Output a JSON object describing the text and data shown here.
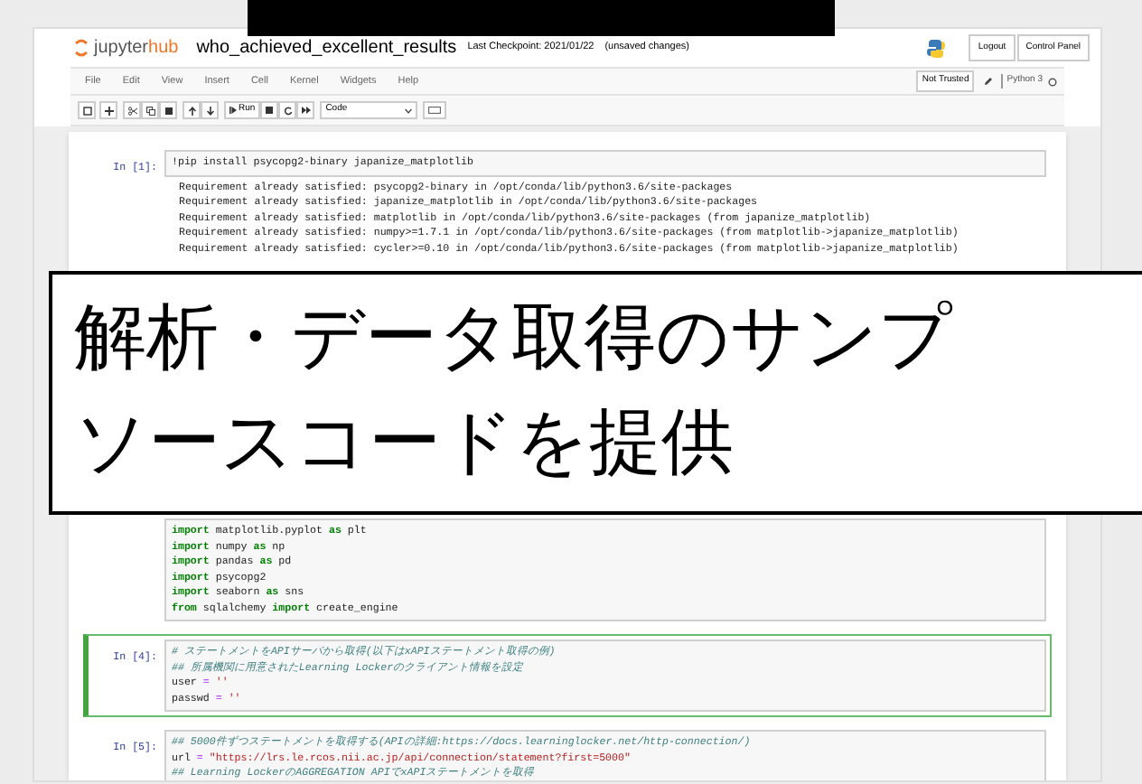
{
  "header": {
    "logo_prefix": "jupyter",
    "logo_suffix": "hub",
    "notebook_name": "who_achieved_excellent_results",
    "checkpoint": "Last Checkpoint: 2021/01/22",
    "unsaved": "(unsaved changes)",
    "buttons": [
      "Logout",
      "Control Panel"
    ]
  },
  "menu": {
    "items": [
      "File",
      "Edit",
      "View",
      "Insert",
      "Cell",
      "Kernel",
      "Widgets",
      "Help"
    ],
    "trust": "Not Trusted",
    "kernel": "Python 3"
  },
  "toolbar": {
    "run_label": "Run",
    "cell_type": "Code"
  },
  "cells": [
    {
      "prompt": "In [1]:",
      "selected": false,
      "lines": [
        [
          {
            "kind": "plain",
            "text": "!pip install psycopg2-binary japanize_matplotlib"
          }
        ]
      ],
      "outputs": [
        "Requirement already satisfied: psycopg2-binary in /opt/conda/lib/python3.6/site-packages",
        "Requirement already satisfied: japanize_matplotlib in /opt/conda/lib/python3.6/site-packages",
        "Requirement already satisfied: matplotlib in /opt/conda/lib/python3.6/site-packages (from japanize_matplotlib)",
        "Requirement already satisfied: numpy>=1.7.1 in /opt/conda/lib/python3.6/site-packages (from matplotlib->japanize_matplotlib)",
        "Requirement already satisfied: cycler>=0.10 in /opt/conda/lib/python3.6/site-packages (from matplotlib->japanize_matplotlib)"
      ]
    },
    {
      "selected": false,
      "lines": [
        [
          {
            "kind": "keyword",
            "text": "import"
          },
          {
            "kind": "plain",
            "text": " matplotlib.pyplot "
          },
          {
            "kind": "keyword",
            "text": "as"
          },
          {
            "kind": "plain",
            "text": " plt"
          }
        ],
        [
          {
            "kind": "keyword",
            "text": "import"
          },
          {
            "kind": "plain",
            "text": " numpy "
          },
          {
            "kind": "keyword",
            "text": "as"
          },
          {
            "kind": "plain",
            "text": " np"
          }
        ],
        [
          {
            "kind": "keyword",
            "text": "import"
          },
          {
            "kind": "plain",
            "text": " pandas "
          },
          {
            "kind": "keyword",
            "text": "as"
          },
          {
            "kind": "plain",
            "text": " pd"
          }
        ],
        [
          {
            "kind": "keyword",
            "text": "import"
          },
          {
            "kind": "plain",
            "text": " psycopg2"
          }
        ],
        [
          {
            "kind": "keyword",
            "text": "import"
          },
          {
            "kind": "plain",
            "text": " seaborn "
          },
          {
            "kind": "keyword",
            "text": "as"
          },
          {
            "kind": "plain",
            "text": " sns"
          }
        ],
        [
          {
            "kind": "keyword",
            "text": "from"
          },
          {
            "kind": "plain",
            "text": " sqlalchemy "
          },
          {
            "kind": "keyword",
            "text": "import"
          },
          {
            "kind": "plain",
            "text": " create_engine"
          }
        ]
      ]
    },
    {
      "prompt": "In [4]:",
      "selected": true,
      "lines": [
        [
          {
            "kind": "comment",
            "text": "# ステートメントをAPIサーバから取得(以下はxAPIステートメント取得の例)"
          }
        ],
        [
          {
            "kind": "comment",
            "text": "## 所属機関に用意されたLearning Lockerのクライアント情報を設定"
          }
        ],
        [
          {
            "kind": "plain",
            "text": "user "
          },
          {
            "kind": "operator",
            "text": "= "
          },
          {
            "kind": "string",
            "text": "''"
          }
        ],
        [
          {
            "kind": "plain",
            "text": "passwd "
          },
          {
            "kind": "operator",
            "text": "= "
          },
          {
            "kind": "string",
            "text": "''"
          }
        ]
      ]
    },
    {
      "prompt": "In [5]:",
      "selected": false,
      "lines": [
        [
          {
            "kind": "comment",
            "text": "## 5000件ずつステートメントを取得する(APIの詳細:https://docs.learninglocker.net/http-connection/)"
          }
        ],
        [
          {
            "kind": "plain",
            "text": "url "
          },
          {
            "kind": "operator",
            "text": "= "
          },
          {
            "kind": "string",
            "text": "\"https://lrs.le.rcos.nii.ac.jp/api/connection/statement?first=5000\""
          }
        ],
        [
          {
            "kind": "comment",
            "text": "## Learning LockerのAGGREGATION APIでxAPIステートメントを取得"
          }
        ]
      ]
    }
  ],
  "overlay": {
    "lines": [
      "解析・データ取得のサンプ",
      "ソースコードを提供"
    ]
  }
}
